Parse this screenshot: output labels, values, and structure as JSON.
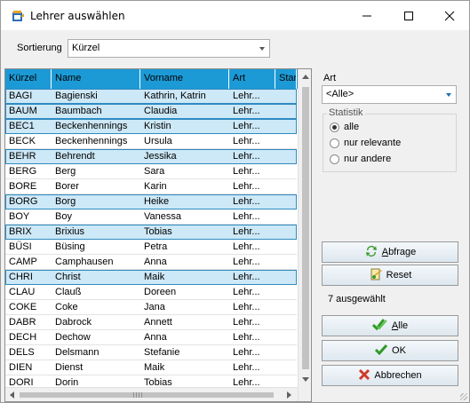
{
  "window": {
    "title": "Lehrer auswählen"
  },
  "sort": {
    "label": "Sortierung",
    "value": "Kürzel"
  },
  "table": {
    "columns": [
      "Kürzel",
      "Name",
      "Vorname",
      "Art",
      "Stan"
    ],
    "rows": [
      {
        "kuerzel": "BAGI",
        "name": "Bagienski",
        "vorname": "Kathrin, Katrin",
        "art": "Lehr...",
        "selected": true
      },
      {
        "kuerzel": "BAUM",
        "name": "Baumbach",
        "vorname": "Claudia",
        "art": "Lehr...",
        "selected": true
      },
      {
        "kuerzel": "BEC1",
        "name": "Beckenhennings",
        "vorname": "Kristin",
        "art": "Lehr...",
        "selected": true
      },
      {
        "kuerzel": "BECK",
        "name": "Beckenhennings",
        "vorname": "Ursula",
        "art": "Lehr...",
        "selected": false
      },
      {
        "kuerzel": "BEHR",
        "name": "Behrendt",
        "vorname": "Jessika",
        "art": "Lehr...",
        "selected": true
      },
      {
        "kuerzel": "BERG",
        "name": "Berg",
        "vorname": "Sara",
        "art": "Lehr...",
        "selected": false
      },
      {
        "kuerzel": "BORE",
        "name": "Borer",
        "vorname": "Karin",
        "art": "Lehr...",
        "selected": false
      },
      {
        "kuerzel": "BORG",
        "name": "Borg",
        "vorname": "Heike",
        "art": "Lehr...",
        "selected": true
      },
      {
        "kuerzel": "BOY",
        "name": "Boy",
        "vorname": "Vanessa",
        "art": "Lehr...",
        "selected": false
      },
      {
        "kuerzel": "BRIX",
        "name": "Brixius",
        "vorname": "Tobias",
        "art": "Lehr...",
        "selected": true
      },
      {
        "kuerzel": "BÜSI",
        "name": "Büsing",
        "vorname": "Petra",
        "art": "Lehr...",
        "selected": false
      },
      {
        "kuerzel": "CAMP",
        "name": "Camphausen",
        "vorname": "Anna",
        "art": "Lehr...",
        "selected": false
      },
      {
        "kuerzel": "CHRI",
        "name": "Christ",
        "vorname": "Maik",
        "art": "Lehr...",
        "selected": true
      },
      {
        "kuerzel": "CLAU",
        "name": "Clauß",
        "vorname": "Doreen",
        "art": "Lehr...",
        "selected": false
      },
      {
        "kuerzel": "COKE",
        "name": "Coke",
        "vorname": "Jana",
        "art": "Lehr...",
        "selected": false
      },
      {
        "kuerzel": "DABR",
        "name": "Dabrock",
        "vorname": "Annett",
        "art": "Lehr...",
        "selected": false
      },
      {
        "kuerzel": "DECH",
        "name": "Dechow",
        "vorname": "Anna",
        "art": "Lehr...",
        "selected": false
      },
      {
        "kuerzel": "DELS",
        "name": "Delsmann",
        "vorname": "Stefanie",
        "art": "Lehr...",
        "selected": false
      },
      {
        "kuerzel": "DIEN",
        "name": "Dienst",
        "vorname": "Maik",
        "art": "Lehr...",
        "selected": false
      },
      {
        "kuerzel": "DORI",
        "name": "Dorin",
        "vorname": "Tobias",
        "art": "Lehr...",
        "selected": false
      }
    ]
  },
  "filter": {
    "art_label": "Art",
    "art_value": "<Alle>",
    "statistik_label": "Statistik",
    "options": [
      "alle",
      "nur relevante",
      "nur andere"
    ],
    "selected_option": "alle"
  },
  "buttons": {
    "abfrage": "Abfrage",
    "reset": "Reset",
    "alle": "Alle",
    "ok": "OK",
    "abbrechen": "Abbrechen"
  },
  "selection_count": "7 ausgewählt",
  "colors": {
    "header": "#1c9ad6",
    "selected_row": "#cde8f7",
    "selected_border": "#2f8ac1"
  }
}
